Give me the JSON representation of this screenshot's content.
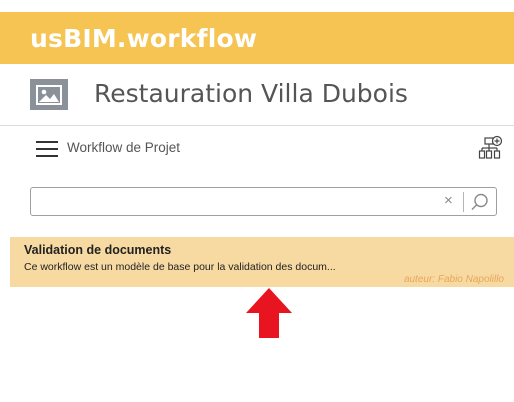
{
  "app": {
    "title": "usBIM.workflow",
    "brand_color": "#f5c453"
  },
  "project": {
    "name": "Restauration Villa Dubois",
    "thumbnail_icon": "image-icon"
  },
  "toolbar": {
    "menu_icon": "hamburger-menu-icon",
    "label": "Workflow de Projet",
    "tree_icon": "add-hierarchy-icon"
  },
  "search": {
    "value": "",
    "placeholder": "",
    "clear_label": "×",
    "search_icon": "magnifier-icon"
  },
  "workflows": [
    {
      "title": "Validation de documents",
      "description": "Ce workflow est un modèle de base pour la validation des docum...",
      "author": "auteur: Fabio Napolillo",
      "highlight_color": "#f7d9a2"
    }
  ],
  "annotation": {
    "arrow_color": "#e8141f",
    "arrow_icon": "red-up-arrow-icon"
  }
}
